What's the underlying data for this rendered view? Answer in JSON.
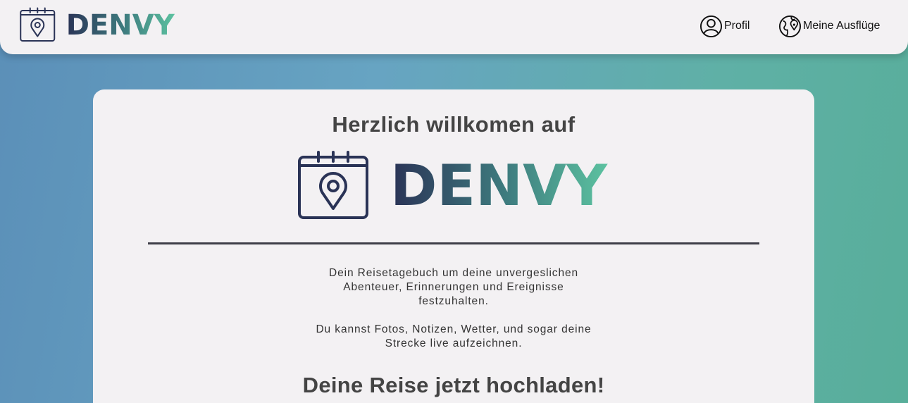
{
  "brand": {
    "name": "DENVY"
  },
  "nav": {
    "profile_label": "Profil",
    "trips_label": "Meine Ausflüge"
  },
  "main": {
    "welcome": "Herzlich willkomen auf",
    "description1": [
      "Dein Reisetagebuch um deine unvergeslichen",
      "Abenteuer, Erinnerungen und Ereignisse",
      "festzuhalten."
    ],
    "description2": [
      "Du kannst Fotos, Notizen, Wetter, und sogar deine",
      "Strecke live aufzeichnen."
    ],
    "upload_heading": "Deine Reise jetzt hochladen!"
  },
  "colors": {
    "logo_dark": "#2a3356",
    "logo_teal": "#3f7e80",
    "logo_green": "#5cc2a0",
    "background_start": "#5b8fb8",
    "background_end": "#58ae9a",
    "surface": "#f3f1f3"
  },
  "icons": {
    "logo": "calendar-pin-icon",
    "profile": "user-circle-icon",
    "trips": "globe-pin-icon"
  }
}
